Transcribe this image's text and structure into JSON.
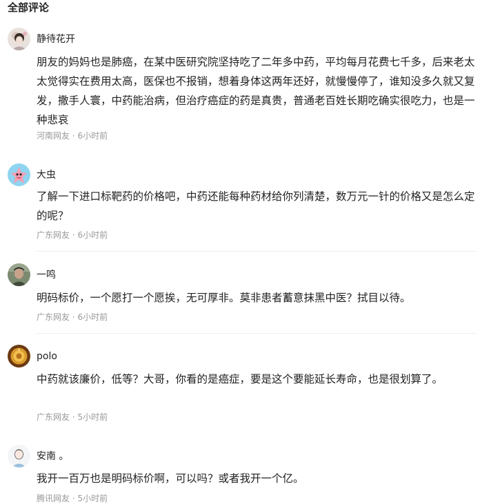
{
  "section_title": "全部评论",
  "comments": [
    {
      "username": "静待花开",
      "avatar_icon": "avatar-flower-girl",
      "text": "朋友的妈妈也是肺癌，在某中医研究院坚持吃了二年多中药，平均每月花费七千多，后来老太太觉得实在费用太高，医保也不报销，想着身体这两年还好，就慢慢停了，谁知没多久就又复发，撒手人寰，中药能治病，但治疗癌症的药是真贵，普通老百姓长期吃确实很吃力，也是一种悲哀",
      "location": "河南网友",
      "separator": "·",
      "time": "6小时前"
    },
    {
      "username": "大虫",
      "avatar_icon": "avatar-pink-starfish",
      "text": "了解一下进口标靶药的价格吧，中药还能每种药材给你列清楚，数万元一针的价格又是怎么定的呢？",
      "location": "广东网友",
      "separator": "·",
      "time": "6小时前"
    },
    {
      "username": "一鸣",
      "avatar_icon": "avatar-man-photo",
      "text": "明码标价，一个愿打一个愿挨，无可厚非。莫非患者蓄意抹黑中医？拭目以待。",
      "location": "广东网友",
      "separator": "·",
      "time": "6小时前"
    },
    {
      "username": "polo",
      "avatar_icon": "avatar-golden-emblem",
      "text": "中药就该廉价，低等？大哥，你看的是癌症，要是这个要能延长寿命，也是很划算了。",
      "location": "广东网友",
      "separator": "·",
      "time": "5小时前"
    },
    {
      "username": "安南 。",
      "avatar_icon": "avatar-sketch-portrait",
      "text": "我开一百万也是明码标价啊，可以吗？或者我开一个亿。",
      "location": "腾讯网友",
      "separator": "·",
      "time": "5小时前"
    }
  ]
}
